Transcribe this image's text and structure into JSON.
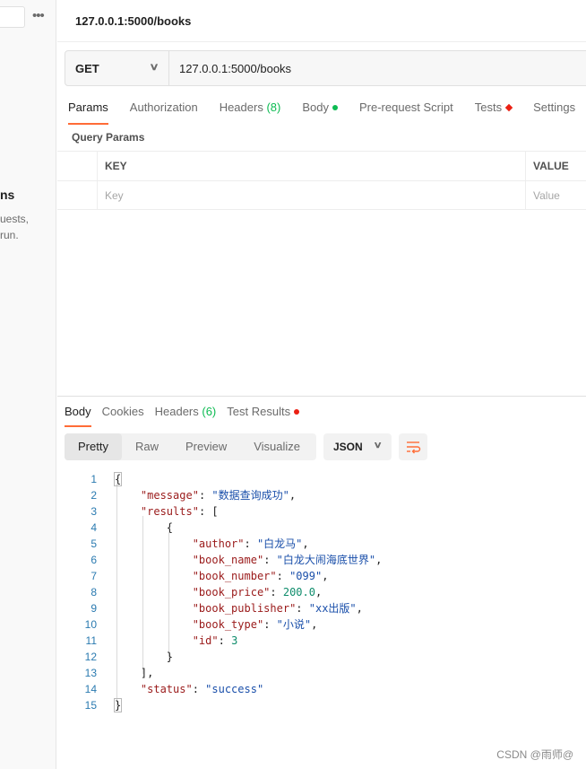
{
  "sidebar": {
    "heading": "ns",
    "text_line1": "uests,",
    "text_line2": " run.",
    "more_icon": "ellipsis-icon"
  },
  "request": {
    "title": "127.0.0.1:5000/books",
    "method": "GET",
    "url": "127.0.0.1:5000/books"
  },
  "request_tabs": [
    {
      "label": "Params",
      "active": true
    },
    {
      "label": "Authorization"
    },
    {
      "label": "Headers",
      "count": "(8)"
    },
    {
      "label": "Body"
    },
    {
      "label": "Pre-request Script"
    },
    {
      "label": "Tests"
    },
    {
      "label": "Settings"
    }
  ],
  "params": {
    "section_title": "Query Params",
    "key_header": "KEY",
    "value_header": "VALUE",
    "key_placeholder": "Key",
    "value_placeholder": "Value"
  },
  "response_tabs": [
    {
      "label": "Body",
      "active": true
    },
    {
      "label": "Cookies"
    },
    {
      "label": "Headers",
      "count": "(6)"
    },
    {
      "label": "Test Results"
    }
  ],
  "view_modes": [
    "Pretty",
    "Raw",
    "Preview",
    "Visualize"
  ],
  "active_view": "Pretty",
  "format": "JSON",
  "code_lines": [
    "1",
    "2",
    "3",
    "4",
    "5",
    "6",
    "7",
    "8",
    "9",
    "10",
    "11",
    "12",
    "13",
    "14",
    "15"
  ],
  "json": {
    "message_key": "\"message\"",
    "message_val": "\"数据查询成功\"",
    "results_key": "\"results\"",
    "author_key": "\"author\"",
    "author_val": "\"白龙马\"",
    "book_name_key": "\"book_name\"",
    "book_name_val": "\"白龙大闹海底世界\"",
    "book_number_key": "\"book_number\"",
    "book_number_val": "\"099\"",
    "book_price_key": "\"book_price\"",
    "book_price_val": "200.0",
    "book_publisher_key": "\"book_publisher\"",
    "book_publisher_val": "\"xx出版\"",
    "book_type_key": "\"book_type\"",
    "book_type_val": "\"小说\"",
    "id_key": "\"id\"",
    "id_val": "3",
    "status_key": "\"status\"",
    "status_val": "\"success\""
  },
  "colors": {
    "accent": "#ff6c37",
    "success": "#0cbb52",
    "error": "#eb2013"
  },
  "watermark": "CSDN @雨师@"
}
